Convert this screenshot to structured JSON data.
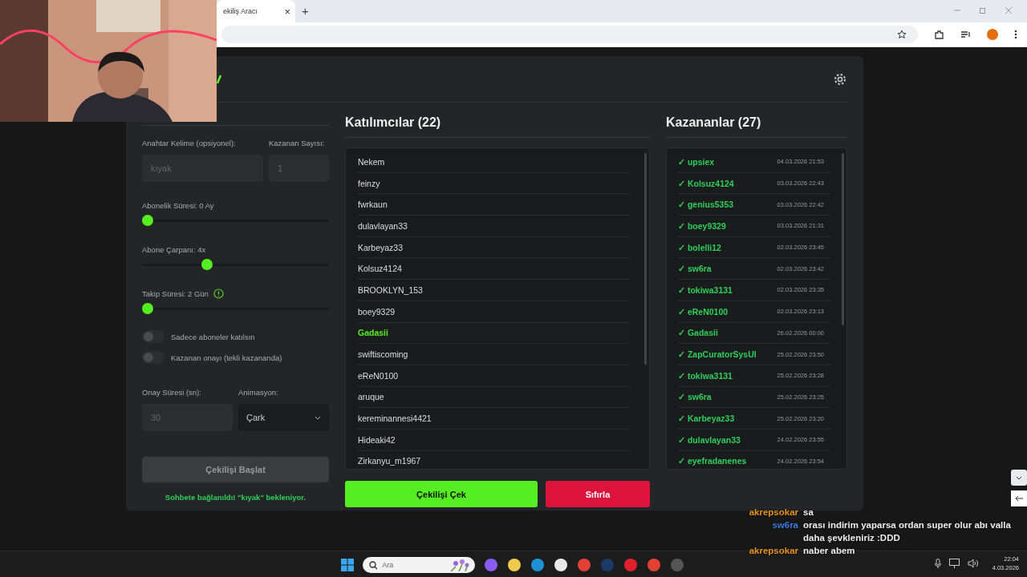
{
  "browser": {
    "tab_title": "ekiliş Aracı",
    "tab_close": "×",
    "new_tab": "+"
  },
  "settings": {
    "keyword_label": "Anahtar Kelime (opsiyonel):",
    "keyword_placeholder": "kıyak",
    "winners_label": "Kazanan Sayısı:",
    "winners_placeholder": "1",
    "sliders": [
      {
        "label": "Abonelik Süresi: 0 Ay",
        "level": 0.0,
        "info": false
      },
      {
        "label": "Abone Çarpanı: 4x",
        "level": 0.34,
        "info": false
      },
      {
        "label": "Takip Süresi: 2 Gün",
        "level": 0.0,
        "info": true
      }
    ],
    "toggles": [
      {
        "label": "Sadece aboneler katılsın",
        "on": false
      },
      {
        "label": "Kazanan onayı (tekli kazananda)",
        "on": false
      }
    ],
    "confirm_label": "Onay Süresi (sn):",
    "confirm_placeholder": "30",
    "animation_label": "Animasyon:",
    "animation_value": "Çark",
    "start_button": "Çekilişi Başlat",
    "status": "Sohbete bağlanıldı! \"kıyak\" bekleniyor."
  },
  "participants": {
    "title": "Katılımcılar (22)",
    "items": [
      {
        "name": "Nekem",
        "selected": false
      },
      {
        "name": "feinzy",
        "selected": false
      },
      {
        "name": "fwrkaun",
        "selected": false
      },
      {
        "name": "dulavlayan33",
        "selected": false
      },
      {
        "name": "Karbeyaz33",
        "selected": false
      },
      {
        "name": "Kolsuz4124",
        "selected": false
      },
      {
        "name": "BROOKLYN_153",
        "selected": false
      },
      {
        "name": "boey9329",
        "selected": false
      },
      {
        "name": "Gadasii",
        "selected": true
      },
      {
        "name": "swiftiscoming",
        "selected": false
      },
      {
        "name": "eReN0100",
        "selected": false
      },
      {
        "name": "aruque",
        "selected": false
      },
      {
        "name": "kereminannesi4421",
        "selected": false
      },
      {
        "name": "Hideaki42",
        "selected": false
      },
      {
        "name": "Zirkanyu_m1967",
        "selected": false
      }
    ],
    "draw_button": "Çekilişi Çek",
    "reset_button": "Sıfırla"
  },
  "winners": {
    "title": "Kazananlar (27)",
    "items": [
      {
        "check": "✓",
        "name": "upsiex",
        "date": "04.03.2026 21:53"
      },
      {
        "check": "✓",
        "name": "Kolsuz4124",
        "date": "03.03.2026 22:43"
      },
      {
        "check": "✓",
        "name": "genius5353",
        "date": "03.03.2026 22:42"
      },
      {
        "check": "✓",
        "name": "boey9329",
        "date": "03.03.2026 21:31"
      },
      {
        "check": "✓",
        "name": "bolelli12",
        "date": "02.03.2026 23:45"
      },
      {
        "check": "✓",
        "name": "sw6ra",
        "date": "02.03.2026 23:42"
      },
      {
        "check": "✓",
        "name": "tokiwa3131",
        "date": "02.03.2026 23:35"
      },
      {
        "check": "✓",
        "name": "eReN0100",
        "date": "02.03.2026 23:13"
      },
      {
        "check": "✓",
        "name": "Gadasii",
        "date": "26.02.2026 00:00"
      },
      {
        "check": "✓",
        "name": "ZapCuratorSysUI",
        "date": "25.02.2026 23:50"
      },
      {
        "check": "✓",
        "name": "tokiwa3131",
        "date": "25.02.2026 23:28"
      },
      {
        "check": "✓",
        "name": "sw6ra",
        "date": "25.02.2026 23:25"
      },
      {
        "check": "✓",
        "name": "Karbeyaz33",
        "date": "25.02.2026 23:20"
      },
      {
        "check": "✓",
        "name": "dulavlayan33",
        "date": "24.02.2026 23:55"
      },
      {
        "check": "✓",
        "name": "eyefradanenes",
        "date": "24.02.2026 23:54"
      }
    ]
  },
  "chat": [
    {
      "user": "akrepsokar",
      "color": "#e8951c",
      "lines": [
        "sa"
      ]
    },
    {
      "user": "sw6ra",
      "color": "#3d7ee0",
      "lines": [
        "orası indirim yaparsa ordan super olur abı valla",
        "daha şevkleniriz :DDD"
      ]
    },
    {
      "user": "akrepsokar",
      "color": "#e8951c",
      "lines": [
        "naber abem"
      ]
    }
  ],
  "taskbar": {
    "search_placeholder": "Ara",
    "time": "22:04",
    "date": "4.03.2026"
  }
}
